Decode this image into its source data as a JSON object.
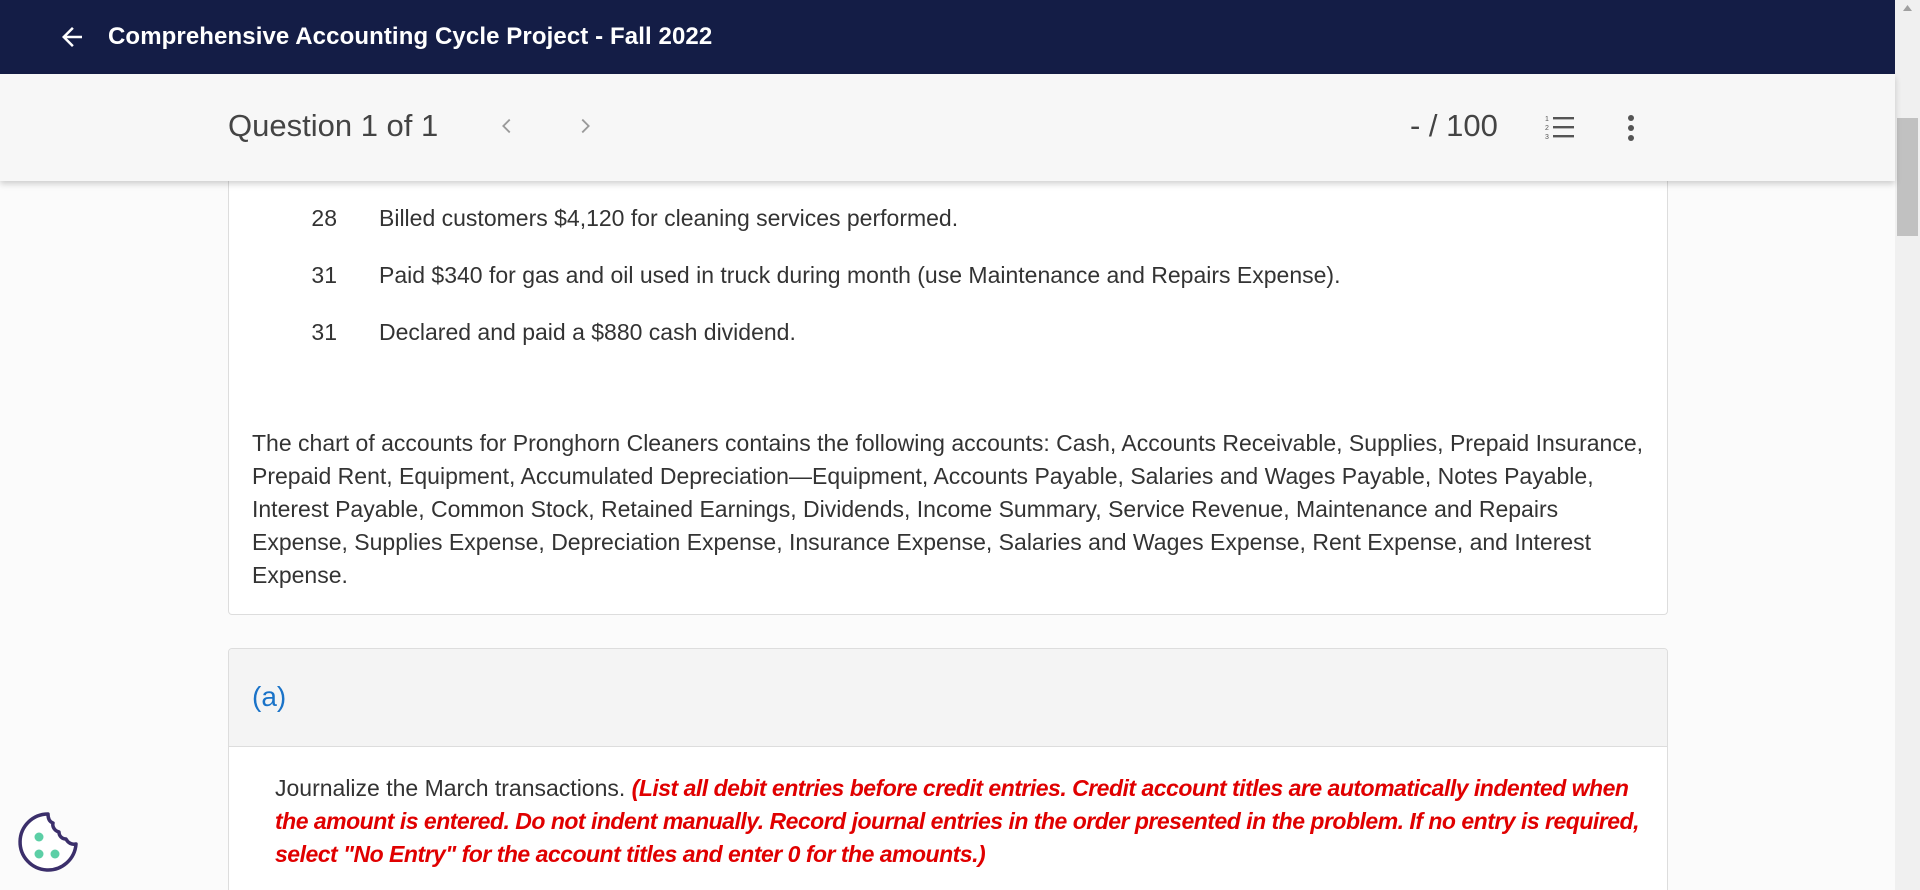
{
  "header": {
    "title": "Comprehensive Accounting Cycle Project - Fall 2022",
    "back_icon": "arrow-left-icon"
  },
  "question_bar": {
    "label": "Question 1 of 1",
    "score": "- / 100",
    "prev_icon": "chevron-left-icon",
    "next_icon": "chevron-right-icon",
    "list_icon": "numbered-list-icon",
    "more_icon": "more-vertical-icon"
  },
  "transactions": [
    {
      "day": "28",
      "text": "Billed customers $4,120 for cleaning services performed."
    },
    {
      "day": "31",
      "text": "Paid $340 for gas and oil used in truck during month (use Maintenance and Repairs Expense)."
    },
    {
      "day": "31",
      "text": "Declared and paid a $880 cash dividend."
    }
  ],
  "chart_of_accounts_text": "The chart of accounts for Pronghorn Cleaners contains the following accounts: Cash, Accounts Receivable, Supplies, Prepaid Insurance, Prepaid Rent, Equipment, Accumulated Depreciation—Equipment, Accounts Payable, Salaries and Wages Payable, Notes Payable, Interest Payable, Common Stock, Retained Earnings, Dividends, Income Summary, Service Revenue, Maintenance and Repairs Expense, Supplies Expense, Depreciation Expense, Insurance Expense, Salaries and Wages Expense, Rent Expense, and Interest Expense.",
  "part_a": {
    "label": "(a)",
    "instruction": "Journalize the March transactions.",
    "instruction_note": "(List all debit entries before credit entries. Credit account titles are automatically indented when the amount is entered. Do not indent manually. Record journal entries in the order presented in the problem. If no entry is required, select \"No Entry\" for the account titles and enter 0 for the amounts.)"
  },
  "colors": {
    "header_bg": "#141d46",
    "link_blue": "#1a73c8",
    "instruction_red": "#e00000",
    "cookie_purple": "#3b2f6b",
    "cookie_dots": "#5ccfa6"
  }
}
